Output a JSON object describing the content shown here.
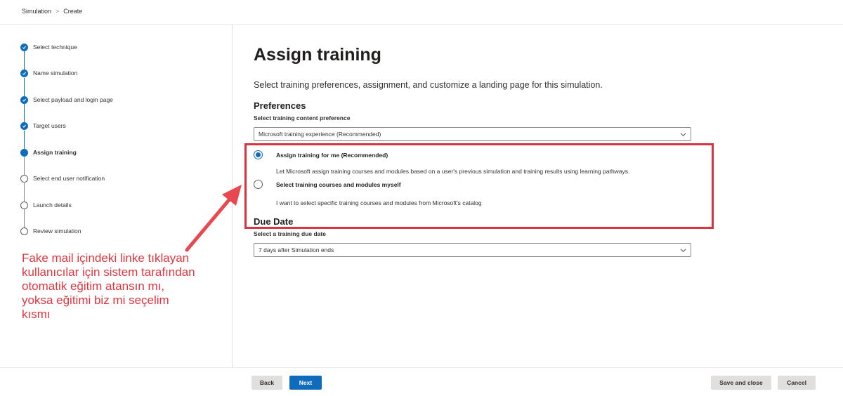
{
  "breadcrumb": {
    "root": "Simulation",
    "current": "Create"
  },
  "wizard": {
    "steps": [
      {
        "label": "Select technique",
        "state": "done"
      },
      {
        "label": "Name simulation",
        "state": "done"
      },
      {
        "label": "Select payload and login page",
        "state": "done"
      },
      {
        "label": "Target users",
        "state": "done"
      },
      {
        "label": "Assign training",
        "state": "current"
      },
      {
        "label": "Select end user notification",
        "state": "pending"
      },
      {
        "label": "Launch details",
        "state": "pending"
      },
      {
        "label": "Review simulation",
        "state": "pending"
      }
    ]
  },
  "annotation": {
    "text": "Fake mail içindeki linke tıklayan kullanıcılar için sistem tarafından otomatik eğitim atansın mı, yoksa eğitimi biz mi seçelim kısmı",
    "color": "#e2363f"
  },
  "main": {
    "title": "Assign training",
    "description": "Select training preferences, assignment, and customize a landing page for this simulation.",
    "preferences": {
      "heading": "Preferences",
      "content_label": "Select training content preference",
      "content_value": "Microsoft training experience (Recommended)",
      "options": [
        {
          "title": "Assign training for me (Recommended)",
          "description": "Let Microsoft assign training courses and modules based on a user's previous simulation and training results using learning pathways.",
          "selected": true
        },
        {
          "title": "Select training courses and modules myself",
          "description": "I want to select specific training courses and modules from Microsoft's catalog",
          "selected": false
        }
      ]
    },
    "due_date": {
      "heading": "Due Date",
      "label": "Select a training due date",
      "value": "7 days after Simulation ends"
    }
  },
  "footer": {
    "back_label": "Back",
    "next_label": "Next",
    "save_close_label": "Save and close",
    "cancel_label": "Cancel"
  },
  "colors": {
    "accent": "#0f6cbd",
    "highlight": "#d8343f"
  }
}
